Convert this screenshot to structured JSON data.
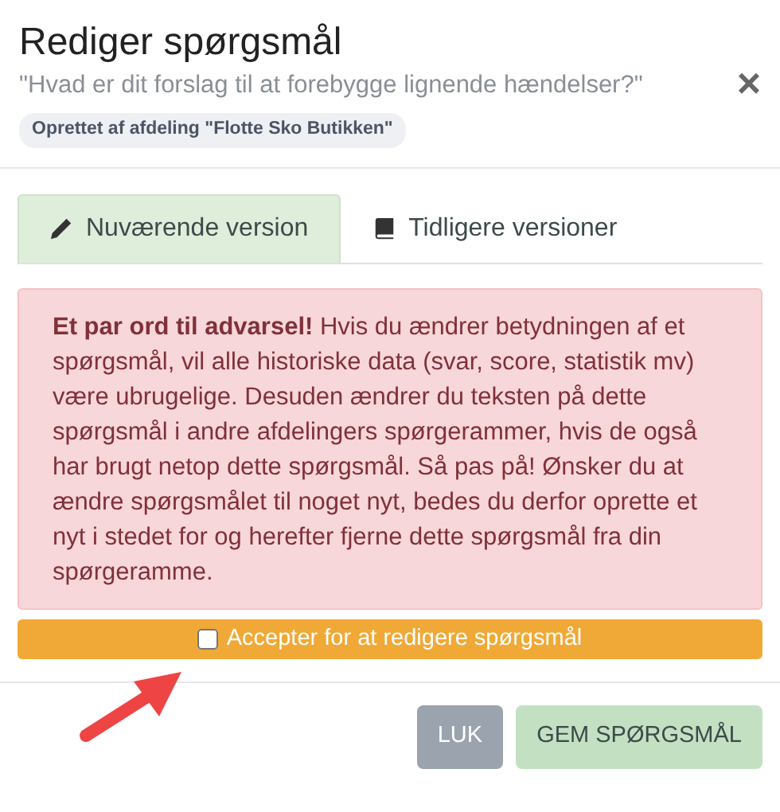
{
  "modal": {
    "title": "Rediger spørgsmål",
    "subtitle": "\"Hvad er dit forslag til at forebygge lignende hændelser?\"",
    "badge": "Oprettet af afdeling \"Flotte Sko Butikken\"",
    "close": "×"
  },
  "tabs": [
    {
      "label": "Nuværende version",
      "selected": true
    },
    {
      "label": "Tidligere versioner",
      "selected": false
    }
  ],
  "warning": "**Et par ord til advarsel!** Hvis du ændrer betydningen af et spørgsmål, vil alle historiske data (svar, score, statistik mv) være ubrugelige. Desuden ændrer du teksten på dette spørgsmål i andre afdelingers spørgerammer, hvis de også har brugt netop dette spørgsmål. Så pas på! Ønsker du at ændre spørgsmålet til noget nyt, bedes du derfor oprette et nyt i stedet for og herefter fjerne dette spørgsmål fra din spørgeramme.",
  "accept": {
    "label": "Accepter for at redigere spørgsmål",
    "checked": false
  },
  "buttons": [
    {
      "label": "LUK",
      "kind": "close",
      "disabled": false
    },
    {
      "label": "GEM SPØRGSMÅL",
      "kind": "save",
      "disabled": true
    }
  ]
}
